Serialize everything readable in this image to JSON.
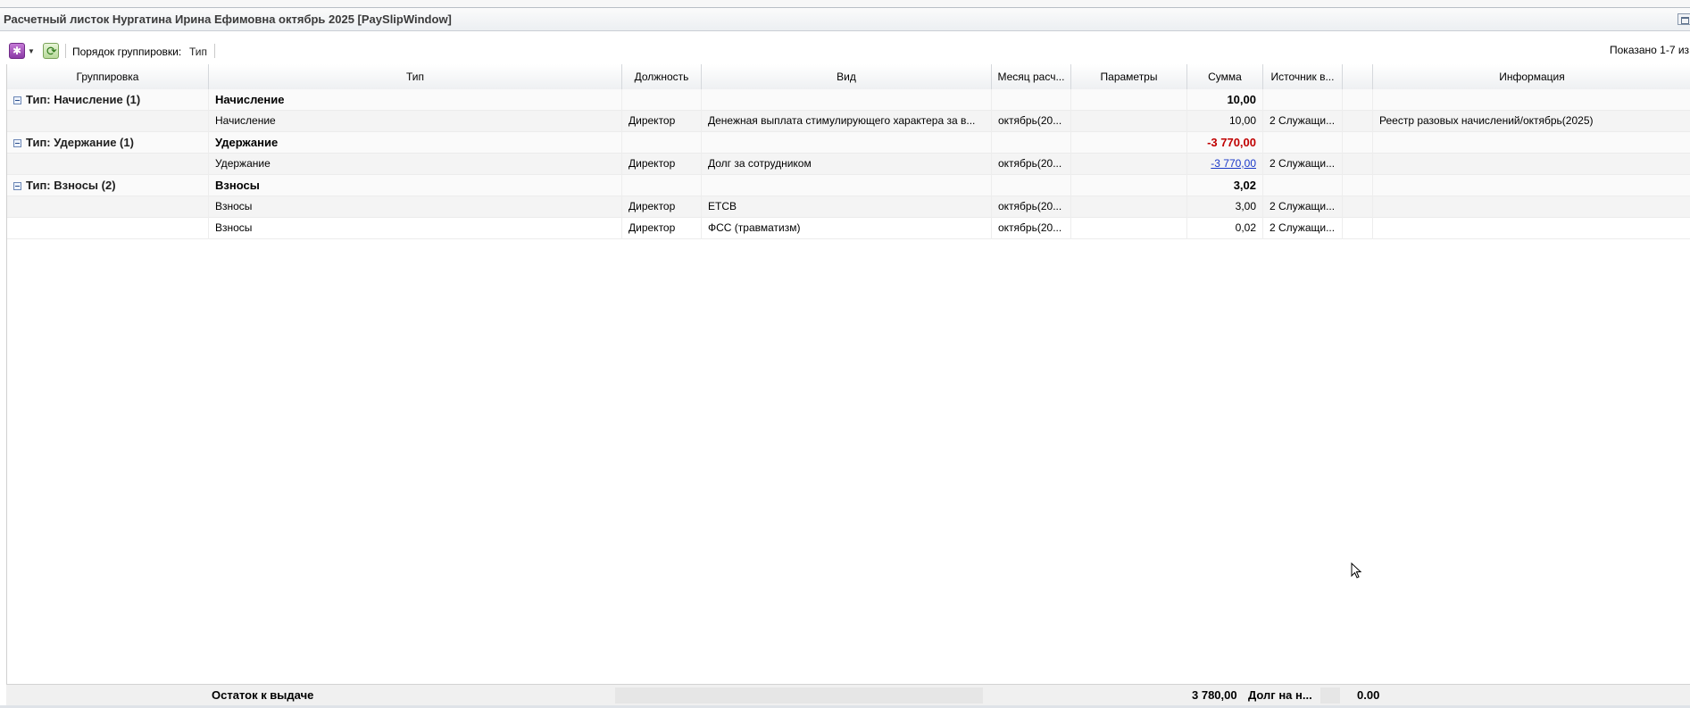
{
  "window": {
    "title": "Расчетный листок Нургатина Ирина Ефимовна октябрь 2025 [PaySlipWindow]"
  },
  "toolbar": {
    "grouping_label": "Порядок группировки:",
    "grouping_value": "Тип",
    "shown_text": "Показано 1-7 из"
  },
  "columns": [
    "Группировка",
    "Тип",
    "Должность",
    "Вид",
    "Месяц расч...",
    "Параметры",
    "Сумма",
    "Источник в...",
    "",
    "Информация"
  ],
  "rows": [
    {
      "kind": "group",
      "group": "Тип: Начисление (1)",
      "type": "Начисление",
      "position": "",
      "vid": "",
      "month": "",
      "params": "",
      "sum": "10,00",
      "source": "",
      "info": ""
    },
    {
      "kind": "data",
      "group": "",
      "type": "Начисление",
      "position": "Директор",
      "vid": "Денежная выплата стимулирующего характера за в...",
      "month": "октябрь(20...",
      "params": "",
      "sum": "10,00",
      "source": "2 Служащи...",
      "info": "Реестр разовых начислений/октябрь(2025)"
    },
    {
      "kind": "group",
      "group": "Тип: Удержание (1)",
      "type": "Удержание",
      "position": "",
      "vid": "",
      "month": "",
      "params": "",
      "sum": "-3 770,00",
      "source": "",
      "info": ""
    },
    {
      "kind": "data",
      "group": "",
      "type": "Удержание",
      "position": "Директор",
      "vid": "Долг за сотрудником",
      "month": "октябрь(20...",
      "params": "",
      "sum": "-3 770,00",
      "source": "2 Служащи...",
      "info": ""
    },
    {
      "kind": "group",
      "group": "Тип: Взносы (2)",
      "type": "Взносы",
      "position": "",
      "vid": "",
      "month": "",
      "params": "",
      "sum": "3,02",
      "source": "",
      "info": ""
    },
    {
      "kind": "data",
      "group": "",
      "type": "Взносы",
      "position": "Директор",
      "vid": "ЕТСВ",
      "month": "октябрь(20...",
      "params": "",
      "sum": "3,00",
      "source": "2 Служащи...",
      "info": ""
    },
    {
      "kind": "data",
      "group": "",
      "type": "Взносы",
      "position": "Директор",
      "vid": "ФСС (травматизм)",
      "month": "октябрь(20...",
      "params": "",
      "sum": "0,02",
      "source": "2 Служащи...",
      "info": ""
    }
  ],
  "footer": {
    "label": "Остаток к выдаче",
    "amount": "3 780,00",
    "debt_label": "Долг на н...",
    "debt_value": "0.00"
  },
  "colors": {
    "negative": "#c00000",
    "link": "#1a39c9"
  }
}
